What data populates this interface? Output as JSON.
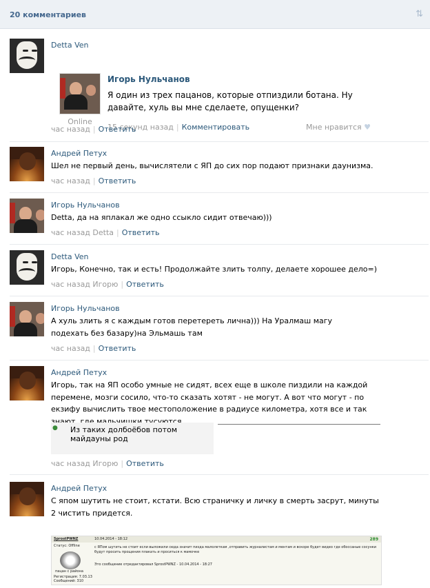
{
  "header": {
    "count_label": "20 комментариев",
    "sort_icon": "sort-icon"
  },
  "comments": [
    {
      "author": "Detta Ven",
      "avatar": "anonymous-mask",
      "repost": {
        "author": "Игорь Нульчанов",
        "status": "Online",
        "text": "Я один из трех пацанов, которые отпиздили ботана. Ну давайте, хуль вы мне сделаете, опущенки?",
        "time": "15 секунд назад",
        "comment_action": "Комментировать",
        "like_label": "Мне нравится"
      },
      "time": "час назад",
      "reply": "Ответить"
    },
    {
      "author": "Андрей Петух",
      "avatar": "hooded-figure",
      "text": "Шел не первый день, вычислятели с ЯП до сих пор подают признаки даунизма.",
      "time": "час назад",
      "reply": "Ответить"
    },
    {
      "author": "Игорь Нульчанов",
      "avatar": "two-guys",
      "text": "Detta, да на яплакал же одно ссыкло сидит отвечаю)))",
      "time": "час назад Detta",
      "reply": "Ответить"
    },
    {
      "author": "Detta Ven",
      "avatar": "anonymous-mask",
      "text": "Игорь, Конечно, так и есть! Продолжайте злить толпу, делаете хорошее дело=)",
      "time": "час назад Игорю",
      "reply": "Ответить"
    },
    {
      "author": "Игорь Нульчанов",
      "avatar": "two-guys",
      "text": "А хуль злить я с каждым готов перетереть лична))) На Уралмаш магу подехать без базару)на Эльмашь там",
      "time": "час назад",
      "reply": "Ответить"
    },
    {
      "author": "Андрей Петух",
      "avatar": "hooded-figure",
      "text": "Игорь, так на ЯП особо умные не сидят, всех еще в школе пиздили на каждой перемене, мозги сосило, что-то сказать хотят - не могут. А вот что могут - по екзифу вычислить твое местоположение в радиусе километра, хотя все и так знают, где мальчишки тусуются.",
      "quote": "Из таких долбоёбов потом майдауны род",
      "time": "час назад Игорю",
      "reply": "Ответить"
    },
    {
      "author": "Андрей Петух",
      "avatar": "hooded-figure",
      "text": "С япом шутить не стоит, кстати. Всю страничку и личку в смерть засрут, минуты 2 чистить придется.",
      "forum": {
        "nick": "SprostPWNZ",
        "date": "10.04.2014 - 18:12",
        "num": "289",
        "status": "Статус: Offline",
        "text": "с ЯПом шутить не стоит если выложили сюда значит пизда малолеткам ,отправить журналистам и ментам и вскоре будет видео где обоссаные сосунки будут просить прощения плакать и проситься к мамочке",
        "edit": "Это сообщение отредактировал SprostPWNZ - 10.04.2014 - 18:27",
        "caption": "пацан с района",
        "reg": "Регистрация: 7.03.13",
        "posts": "Сообщений: 310"
      }
    }
  ]
}
